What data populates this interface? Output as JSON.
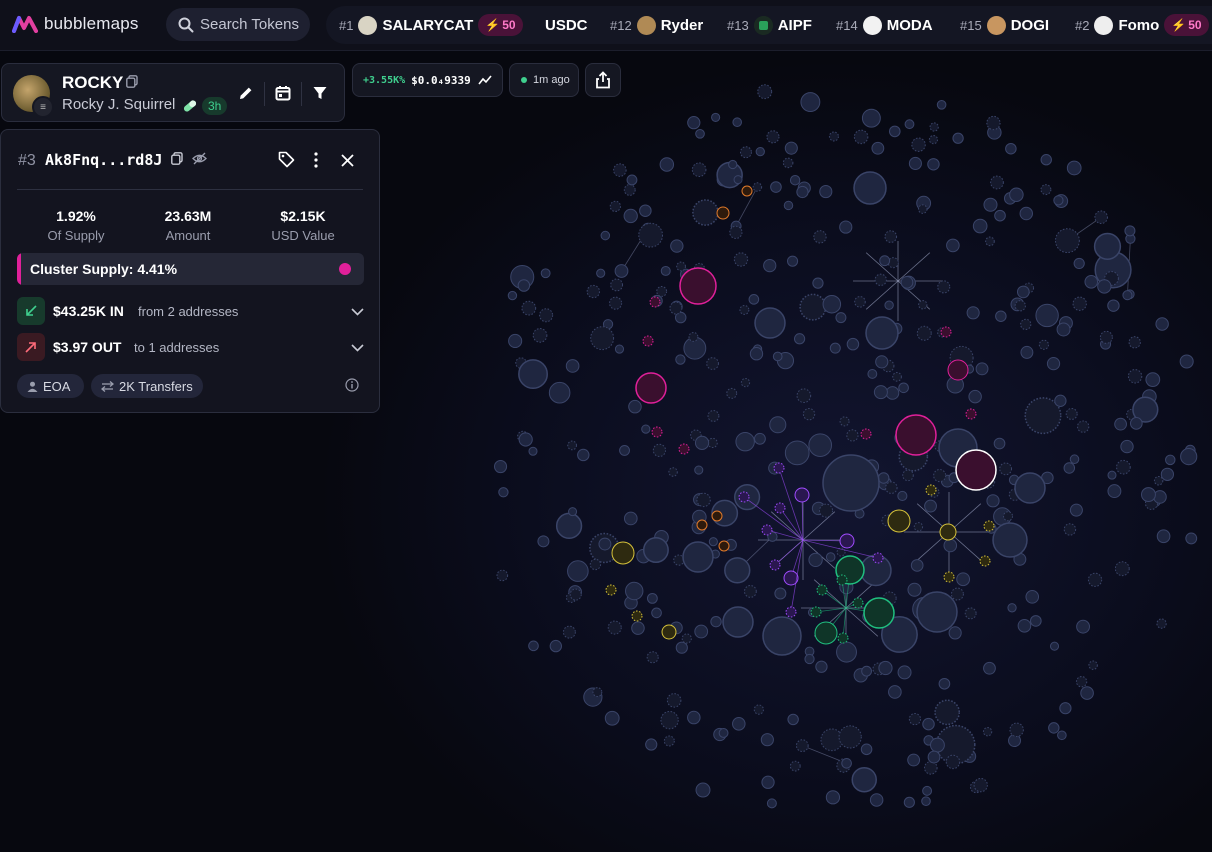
{
  "app": {
    "logo_text": "bubblemaps"
  },
  "search": {
    "label": "Search Tokens",
    "icon": "search-icon"
  },
  "ticker": [
    {
      "rank": "#1",
      "name": "SALARYCAT",
      "boost": "50",
      "icon_color": "#d9d4c4"
    },
    {
      "rank": "",
      "name": "USDC",
      "boost": "",
      "icon_color": ""
    },
    {
      "rank": "#12",
      "name": "Ryder",
      "boost": "",
      "icon_color": "#b08a55"
    },
    {
      "rank": "#13",
      "name": "AIPF",
      "boost": "",
      "icon_color": "#2aa05a"
    },
    {
      "rank": "#14",
      "name": "MODA",
      "boost": "",
      "icon_color": "#f2f2f2"
    },
    {
      "rank": "#15",
      "name": "DOGI",
      "boost": "",
      "icon_color": "#c89660"
    },
    {
      "rank": "#2",
      "name": "Fomo",
      "boost": "50",
      "icon_color": "#eeeeee"
    }
  ],
  "token": {
    "symbol": "ROCKY",
    "name": "Rocky J. Squirrel",
    "age": "3h",
    "chain_badge": "≡"
  },
  "price_chip": {
    "change": "+3.55K%",
    "price": "$0.0₄9339"
  },
  "updated_chip": {
    "text": "1m ago"
  },
  "panel": {
    "rank": "#3",
    "address": "Ak8Fnq...rd8J",
    "stats": [
      {
        "value": "1.92%",
        "label": "Of Supply"
      },
      {
        "value": "23.63M",
        "label": "Amount"
      },
      {
        "value": "$2.15K",
        "label": "USD Value"
      }
    ],
    "cluster_supply": "Cluster Supply: 4.41%",
    "cluster_color": "#e0209a",
    "flow_in": {
      "amount": "$43.25K IN",
      "desc": "from 2 addresses"
    },
    "flow_out": {
      "amount": "$3.97 OUT",
      "desc": "to 1 addresses"
    },
    "tags": [
      "EOA",
      "2K Transfers"
    ]
  },
  "colors": {
    "accent_pink": "#e0209a",
    "cluster_purple": "#a04cff",
    "cluster_green": "#20c080",
    "cluster_yellow": "#d6c23a",
    "cluster_orange": "#e07a2a",
    "bubble_default": "#1f2640",
    "bubble_border": "#3a4468"
  }
}
